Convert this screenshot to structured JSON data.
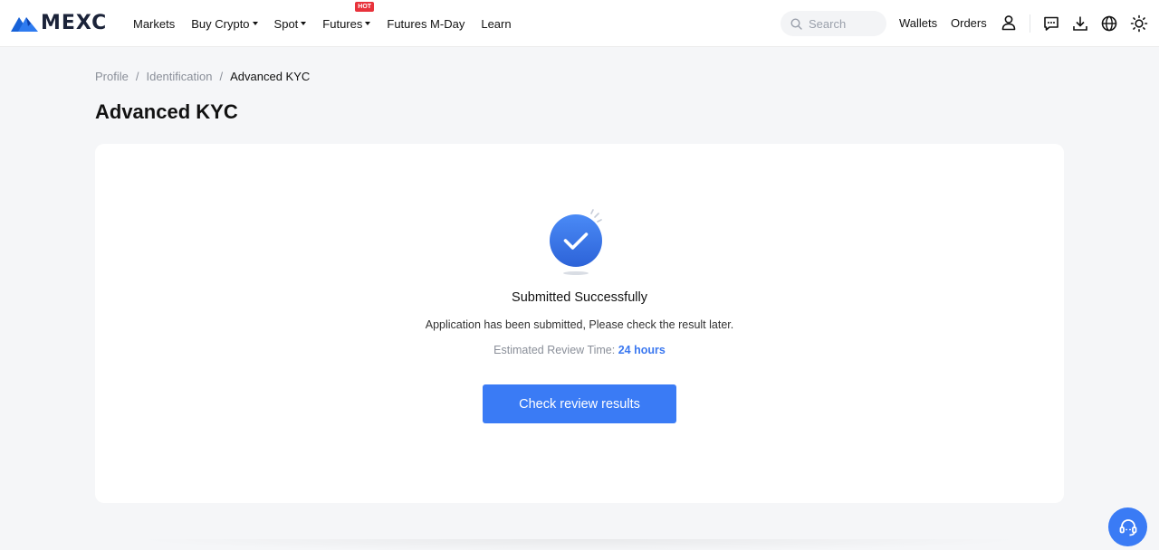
{
  "brand": {
    "name": "MEXC"
  },
  "nav": {
    "items": [
      {
        "label": "Markets",
        "caret": false,
        "badge": ""
      },
      {
        "label": "Buy Crypto",
        "caret": true,
        "badge": ""
      },
      {
        "label": "Spot",
        "caret": true,
        "badge": ""
      },
      {
        "label": "Futures",
        "caret": true,
        "badge": "HOT"
      },
      {
        "label": "Futures M-Day",
        "caret": false,
        "badge": ""
      },
      {
        "label": "Learn",
        "caret": false,
        "badge": ""
      }
    ]
  },
  "header": {
    "search_placeholder": "Search",
    "wallets_label": "Wallets",
    "orders_label": "Orders",
    "icons": [
      "search-icon",
      "user-icon",
      "chat-icon",
      "download-icon",
      "globe-icon",
      "theme-sun-icon"
    ]
  },
  "breadcrumb": {
    "items": [
      {
        "label": "Profile"
      },
      {
        "label": "Identification"
      },
      {
        "label": "Advanced KYC"
      }
    ],
    "separator": "/"
  },
  "page": {
    "title": "Advanced KYC"
  },
  "status": {
    "title": "Submitted Successfully",
    "description": "Application has been submitted, Please check the result later.",
    "review_time_label": "Estimated Review Time:",
    "review_time_value": "24 hours",
    "button_label": "Check review results"
  },
  "colors": {
    "accent": "#3a7bf5",
    "hot_badge": "#e8323b",
    "background": "#f5f6f8",
    "card": "#ffffff"
  }
}
